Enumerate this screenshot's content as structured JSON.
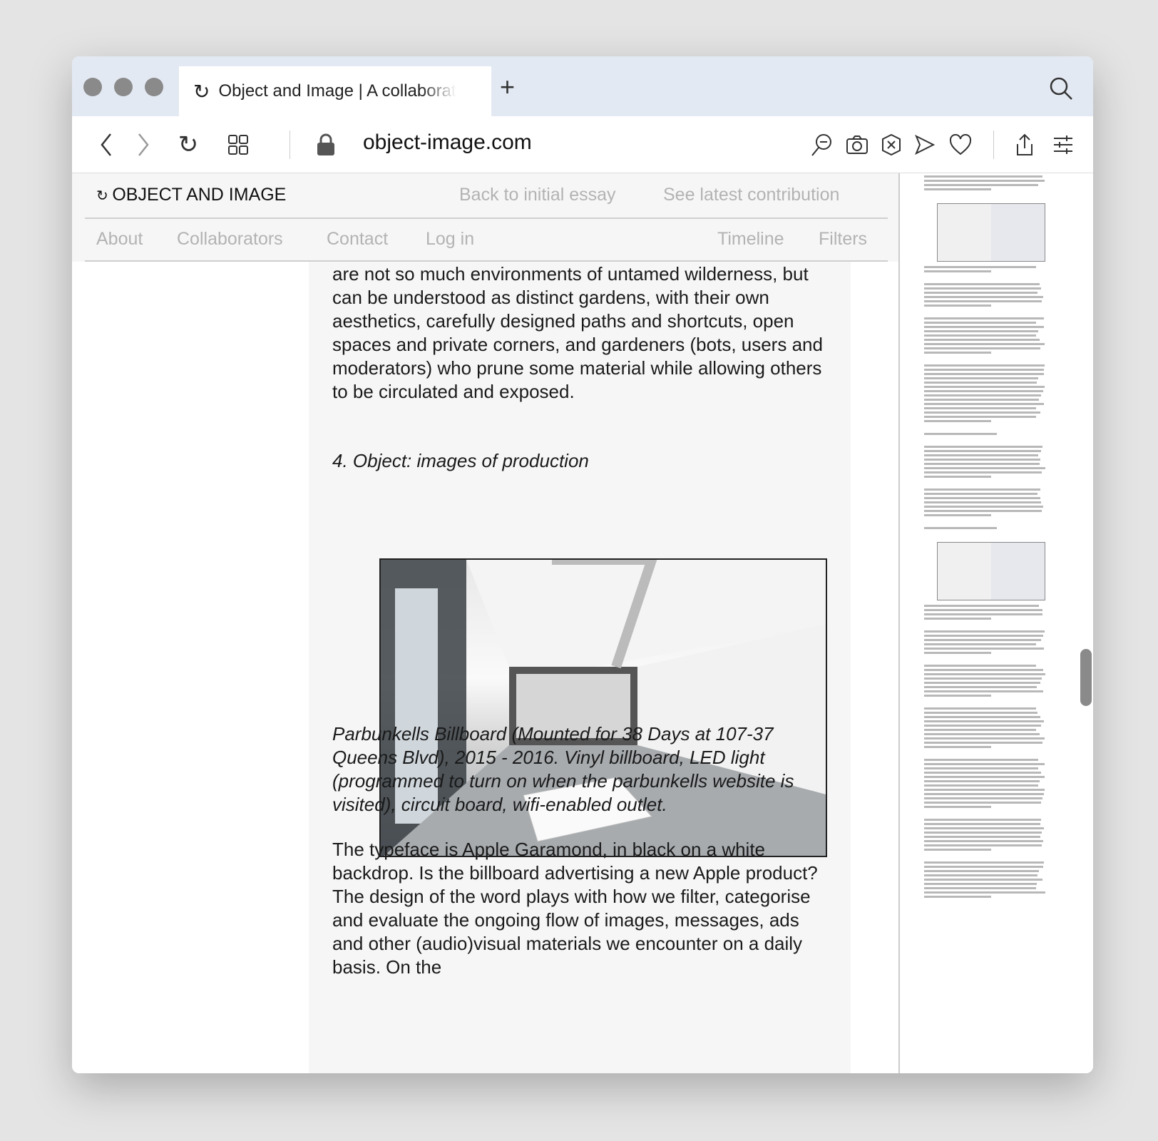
{
  "browser": {
    "tab_title": "Object and Image | A collaborat",
    "url": "object-image.com"
  },
  "site": {
    "brand": "OBJECT AND IMAGE",
    "header_links": [
      "Back to initial essay",
      "See latest contribution"
    ],
    "nav_left": [
      "About",
      "Collaborators",
      "Contact",
      "Log in"
    ],
    "nav_right": [
      "Timeline",
      "Filters"
    ]
  },
  "article": {
    "para1": "are not so much environments of untamed wilderness, but can be understood as distinct gardens, with their own aesthetics, carefully designed paths and shortcuts, open spaces and private corners, and gardeners (bots, users and moderators) who prune some material while allowing others to be circulated and exposed.",
    "heading": "4. Object: images of production",
    "caption": "Parbunkells Billboard (Mounted for 38 Days at 107-37 Queens Blvd), 2015 - 2016. Vinyl billboard, LED light (programmed to turn on when the parbunkells website is visited), circuit board, wifi-enabled outlet.",
    "para2": "The typeface is Apple Garamond, in black on a white backdrop. Is the billboard advertising a new Apple product? The design of the word plays with how we filter, categorise and evaluate the ongoing flow of images, messages, ads and other (audio)visual materials we encounter on a daily basis. On the"
  }
}
